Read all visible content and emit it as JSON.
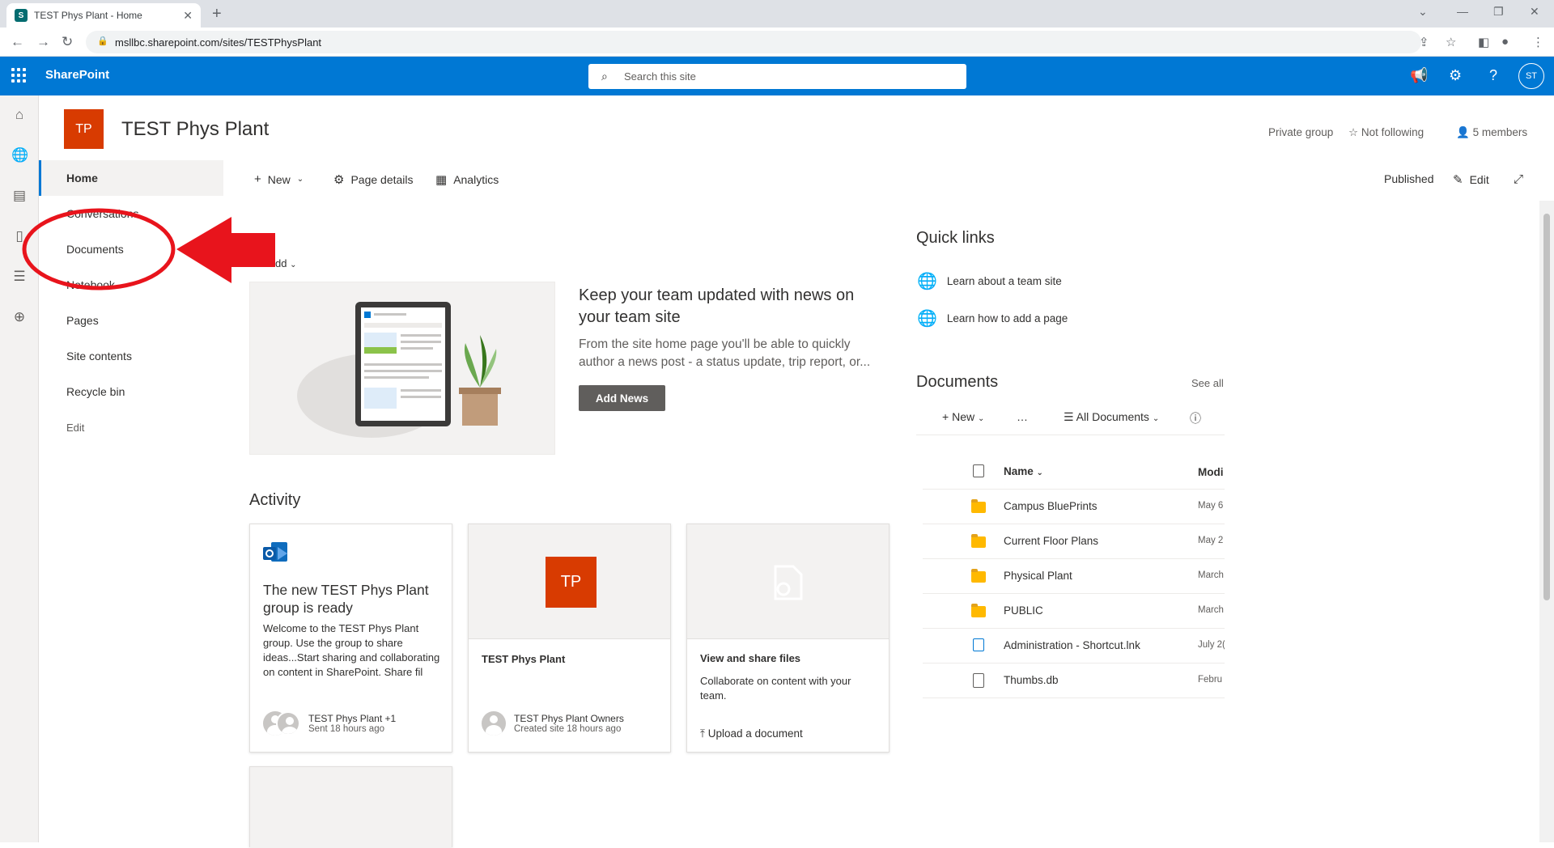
{
  "browser": {
    "tab_title": "TEST Phys Plant - Home",
    "favicon_letter": "S",
    "url": "msllbc.sharepoint.com/sites/TESTPhysPlant"
  },
  "suite": {
    "app_name": "SharePoint",
    "search_placeholder": "Search this site",
    "avatar_initials": "ST",
    "accent": "#0078d4"
  },
  "site": {
    "logo_initials": "TP",
    "logo_color": "#d83b01",
    "title": "TEST Phys Plant",
    "privacy": "Private group",
    "follow": "Not following",
    "members": "5 members"
  },
  "leftnav": {
    "items": [
      {
        "label": "Home",
        "active": true
      },
      {
        "label": "Conversations"
      },
      {
        "label": "Documents"
      },
      {
        "label": "Notebook"
      },
      {
        "label": "Pages"
      },
      {
        "label": "Site contents"
      },
      {
        "label": "Recycle bin"
      }
    ],
    "edit": "Edit"
  },
  "commandbar": {
    "new": "New",
    "page_details": "Page details",
    "analytics": "Analytics",
    "published": "Published",
    "edit": "Edit"
  },
  "news": {
    "heading": "ws",
    "add": "dd",
    "headline": "Keep your team updated with news on your team site",
    "body": "From the site home page you'll be able to quickly author a news post - a status update, trip report, or...",
    "button": "Add News"
  },
  "activity": {
    "heading": "Activity",
    "cards": [
      {
        "title": "The new TEST Phys Plant group is ready",
        "desc": "Welcome to the TEST Phys Plant group. Use the group to share ideas...Start sharing and collaborating on content in SharePoint. Share fil",
        "who": "TEST Phys Plant +1",
        "when": "Sent 18 hours ago"
      },
      {
        "logo": "TP",
        "title": "TEST Phys Plant",
        "who": "TEST Phys Plant Owners",
        "when": "Created site 18 hours ago"
      },
      {
        "title": "View and share files",
        "desc": "Collaborate on content with your team.",
        "action": "Upload a document"
      }
    ]
  },
  "quicklinks": {
    "heading": "Quick links",
    "items": [
      "Learn about a team site",
      "Learn how to add a page"
    ]
  },
  "documents": {
    "heading": "Documents",
    "see_all": "See all",
    "new": "New",
    "more": "…",
    "view": "All Documents",
    "col_name": "Name",
    "col_modified": "Modi",
    "rows": [
      {
        "name": "Campus BluePrints",
        "type": "folder",
        "modified": "May 6"
      },
      {
        "name": "Current Floor Plans",
        "type": "folder",
        "modified": "May 2"
      },
      {
        "name": "Physical Plant",
        "type": "folder",
        "modified": "March"
      },
      {
        "name": "PUBLIC",
        "type": "folder",
        "modified": "March"
      },
      {
        "name": "Administration - Shortcut.lnk",
        "type": "file",
        "modified": "July 2("
      },
      {
        "name": "Thumbs.db",
        "type": "file",
        "modified": "Febru"
      }
    ]
  },
  "annotation_color": "#e8141c"
}
